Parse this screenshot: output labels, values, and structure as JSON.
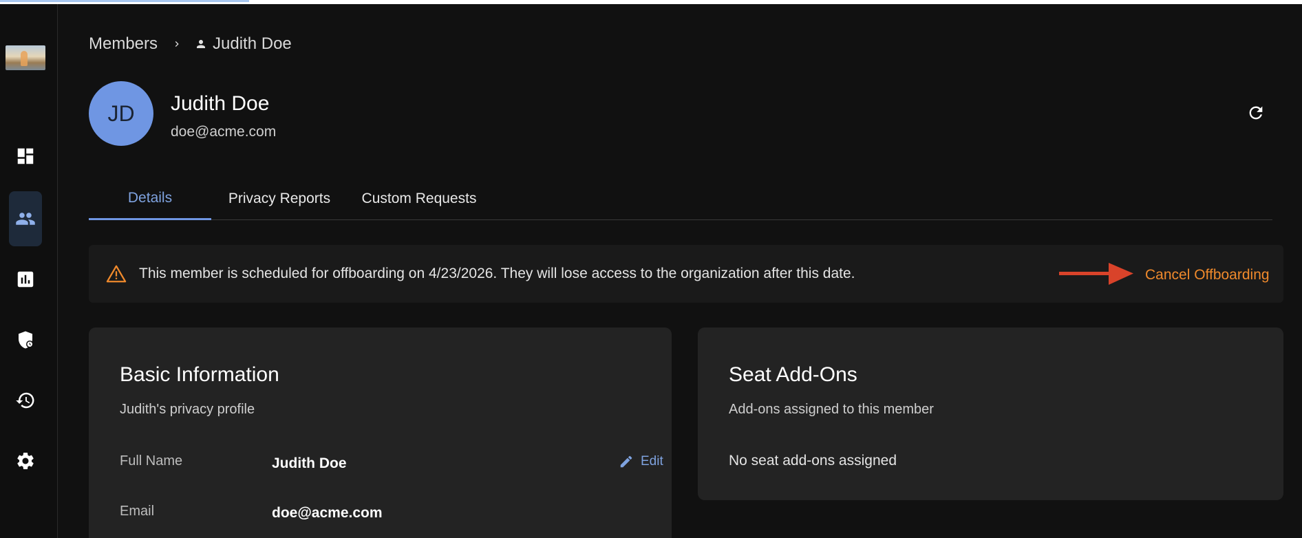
{
  "breadcrumb": {
    "root": "Members",
    "current": "Judith Doe"
  },
  "member": {
    "initials": "JD",
    "name": "Judith Doe",
    "email": "doe@acme.com"
  },
  "tabs": [
    {
      "label": "Details",
      "active": true
    },
    {
      "label": "Privacy Reports",
      "active": false
    },
    {
      "label": "Custom Requests",
      "active": false
    }
  ],
  "banner": {
    "message": "This member is scheduled for offboarding on 4/23/2026. They will lose access to the organization after this date.",
    "action": "Cancel Offboarding",
    "warning_color": "#f08a2c",
    "arrow_color": "#d9432a"
  },
  "basic_info": {
    "title": "Basic Information",
    "subtitle": "Judith's privacy profile",
    "edit_label": "Edit",
    "fields": [
      {
        "label": "Full Name",
        "value": "Judith Doe"
      },
      {
        "label": "Email",
        "value": "doe@acme.com"
      }
    ]
  },
  "seat_addons": {
    "title": "Seat Add-Ons",
    "subtitle": "Add-ons assigned to this member",
    "empty": "No seat add-ons assigned"
  },
  "sidebar": {
    "items": [
      {
        "icon": "dashboard-icon",
        "active": false
      },
      {
        "icon": "members-icon",
        "active": true
      },
      {
        "icon": "reports-icon",
        "active": false
      },
      {
        "icon": "security-shield-icon",
        "active": false
      },
      {
        "icon": "history-icon",
        "active": false
      },
      {
        "icon": "settings-icon",
        "active": false
      }
    ]
  },
  "colors": {
    "accent": "#6f96e3",
    "background": "#111111",
    "card": "#232323"
  }
}
